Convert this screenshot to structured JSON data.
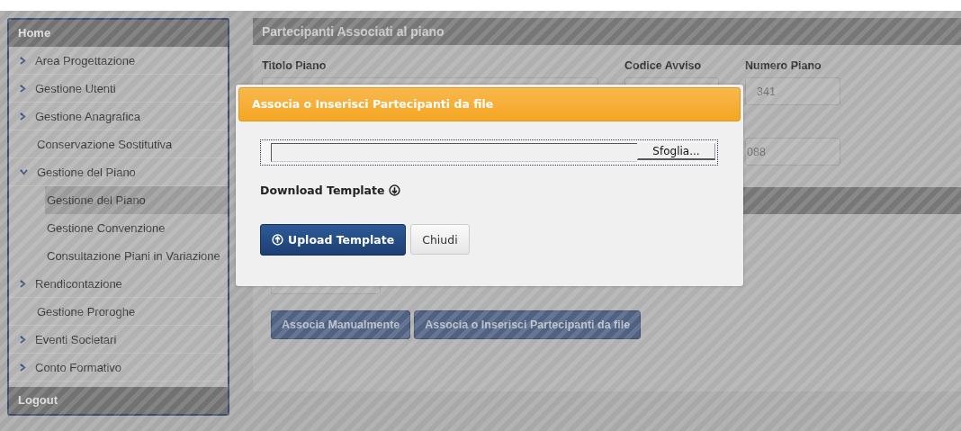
{
  "sidebar": {
    "header": "Home",
    "items": [
      {
        "label": "Area Progettazione",
        "kind": "group",
        "expanded": false
      },
      {
        "label": "Gestione Utenti",
        "kind": "group",
        "expanded": false
      },
      {
        "label": "Gestione Anagrafica",
        "kind": "group",
        "expanded": false
      },
      {
        "label": "Conservazione Sostitutiva",
        "kind": "link"
      },
      {
        "label": "Gestione del Piano",
        "kind": "group",
        "expanded": true,
        "children": [
          {
            "label": "Gestione del Piano",
            "selected": true
          },
          {
            "label": "Gestione Convenzione",
            "selected": false
          },
          {
            "label": "Consultazione Piani in Variazione",
            "selected": false
          }
        ]
      },
      {
        "label": "Rendicontazione",
        "kind": "group",
        "expanded": false
      },
      {
        "label": "Gestione Proroghe",
        "kind": "link"
      },
      {
        "label": "Eventi Societari",
        "kind": "group",
        "expanded": false
      },
      {
        "label": "Conto Formativo",
        "kind": "group",
        "expanded": false
      }
    ],
    "footer": "Logout"
  },
  "panel": {
    "title": "Partecipanti Associati al piano",
    "fields": [
      {
        "label": "Titolo Piano"
      },
      {
        "label": "Codice Avviso"
      },
      {
        "label": "Numero Piano",
        "value": "341"
      }
    ],
    "second_row_value": "088",
    "buttons": [
      "Associa Manualmente",
      "Associa o Inserisci Partecipanti da file"
    ]
  },
  "modal": {
    "title": "Associa o Inserisci Partecipanti da file",
    "browse_button": "Sfoglia...",
    "download_link": "Download Template",
    "upload_button": "Upload Template",
    "close_button": "Chiudi"
  }
}
